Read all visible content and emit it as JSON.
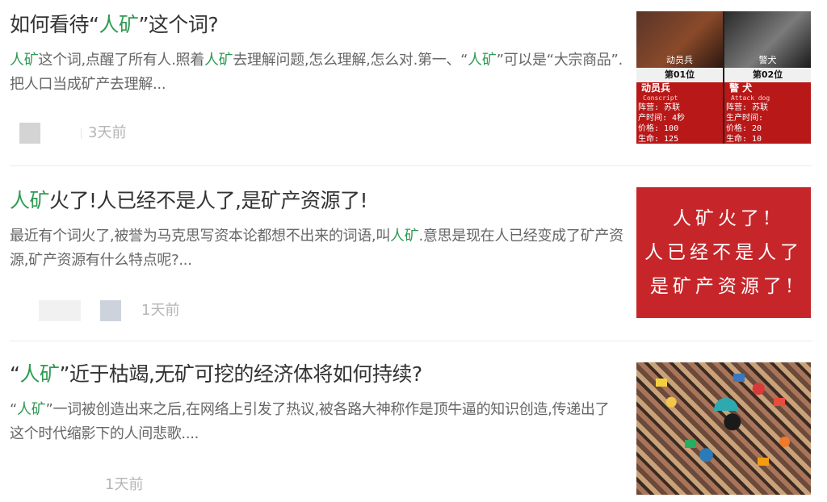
{
  "articles": [
    {
      "title": [
        "如何看待“",
        "人矿",
        "”这个词?"
      ],
      "summary": [
        "人矿",
        "这个词,点醒了所有人.照着",
        "人矿",
        "去理解问题,怎么理解,怎么对.第一、“",
        "人矿",
        "”可以是“大宗商品”.把人口当成矿产去理解..."
      ],
      "time": "3天前",
      "thumb": {
        "kind": "game-card",
        "cards": [
          {
            "portrait": "动员兵",
            "rank": "第01位",
            "name": "动员兵",
            "en": "Conscript",
            "stats": [
              "阵营: 苏联",
              "产时间: 4秒",
              "价格: 100",
              "生命: 125"
            ]
          },
          {
            "portrait": "警犬",
            "rank": "第02位",
            "name": "警 犬",
            "en": "Attack dog",
            "stats": [
              "阵营: 苏联",
              "生产时间:",
              "价格: 20",
              "生命: 10"
            ]
          }
        ]
      }
    },
    {
      "title": [
        "人矿",
        "火了!人已经不是人了,是矿产资源了!"
      ],
      "summary": [
        "最近有个词火了,被誉为马克思写资本论都想不出来的词语,叫",
        "人矿",
        ".意思是现在人已经变成了矿产资源,矿产资源有什么特点呢?..."
      ],
      "time": "1天前",
      "thumb": {
        "kind": "text-card",
        "lines": [
          "人矿火了!",
          "人已经不是人了",
          "是矿产资源了!"
        ]
      }
    },
    {
      "title": [
        "“",
        "人矿",
        "”近于枯竭,无矿可挖的经济体将如何持续?"
      ],
      "summary": [
        "“",
        "人矿",
        "”一词被创造出来之后,在网络上引发了热议,被各路大神称作是顶牛逼的知识创造,传递出了这个时代缩影下的人间悲歌...."
      ],
      "time": "1天前",
      "thumb": {
        "kind": "crowd-photo"
      }
    }
  ],
  "colors": {
    "highlight": "#2e9a52",
    "title": "#333333",
    "summary": "#666666",
    "meta": "#b5b5b5",
    "card_red": "#c6262a"
  }
}
